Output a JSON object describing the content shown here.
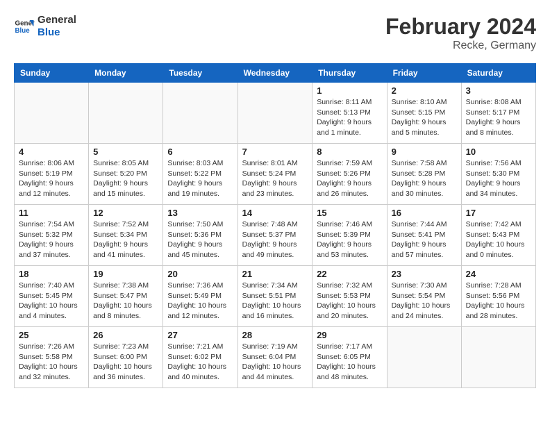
{
  "header": {
    "logo_line1": "General",
    "logo_line2": "Blue",
    "month_year": "February 2024",
    "location": "Recke, Germany"
  },
  "days_of_week": [
    "Sunday",
    "Monday",
    "Tuesday",
    "Wednesday",
    "Thursday",
    "Friday",
    "Saturday"
  ],
  "weeks": [
    [
      {
        "day": "",
        "info": ""
      },
      {
        "day": "",
        "info": ""
      },
      {
        "day": "",
        "info": ""
      },
      {
        "day": "",
        "info": ""
      },
      {
        "day": "1",
        "info": "Sunrise: 8:11 AM\nSunset: 5:13 PM\nDaylight: 9 hours\nand 1 minute."
      },
      {
        "day": "2",
        "info": "Sunrise: 8:10 AM\nSunset: 5:15 PM\nDaylight: 9 hours\nand 5 minutes."
      },
      {
        "day": "3",
        "info": "Sunrise: 8:08 AM\nSunset: 5:17 PM\nDaylight: 9 hours\nand 8 minutes."
      }
    ],
    [
      {
        "day": "4",
        "info": "Sunrise: 8:06 AM\nSunset: 5:19 PM\nDaylight: 9 hours\nand 12 minutes."
      },
      {
        "day": "5",
        "info": "Sunrise: 8:05 AM\nSunset: 5:20 PM\nDaylight: 9 hours\nand 15 minutes."
      },
      {
        "day": "6",
        "info": "Sunrise: 8:03 AM\nSunset: 5:22 PM\nDaylight: 9 hours\nand 19 minutes."
      },
      {
        "day": "7",
        "info": "Sunrise: 8:01 AM\nSunset: 5:24 PM\nDaylight: 9 hours\nand 23 minutes."
      },
      {
        "day": "8",
        "info": "Sunrise: 7:59 AM\nSunset: 5:26 PM\nDaylight: 9 hours\nand 26 minutes."
      },
      {
        "day": "9",
        "info": "Sunrise: 7:58 AM\nSunset: 5:28 PM\nDaylight: 9 hours\nand 30 minutes."
      },
      {
        "day": "10",
        "info": "Sunrise: 7:56 AM\nSunset: 5:30 PM\nDaylight: 9 hours\nand 34 minutes."
      }
    ],
    [
      {
        "day": "11",
        "info": "Sunrise: 7:54 AM\nSunset: 5:32 PM\nDaylight: 9 hours\nand 37 minutes."
      },
      {
        "day": "12",
        "info": "Sunrise: 7:52 AM\nSunset: 5:34 PM\nDaylight: 9 hours\nand 41 minutes."
      },
      {
        "day": "13",
        "info": "Sunrise: 7:50 AM\nSunset: 5:36 PM\nDaylight: 9 hours\nand 45 minutes."
      },
      {
        "day": "14",
        "info": "Sunrise: 7:48 AM\nSunset: 5:37 PM\nDaylight: 9 hours\nand 49 minutes."
      },
      {
        "day": "15",
        "info": "Sunrise: 7:46 AM\nSunset: 5:39 PM\nDaylight: 9 hours\nand 53 minutes."
      },
      {
        "day": "16",
        "info": "Sunrise: 7:44 AM\nSunset: 5:41 PM\nDaylight: 9 hours\nand 57 minutes."
      },
      {
        "day": "17",
        "info": "Sunrise: 7:42 AM\nSunset: 5:43 PM\nDaylight: 10 hours\nand 0 minutes."
      }
    ],
    [
      {
        "day": "18",
        "info": "Sunrise: 7:40 AM\nSunset: 5:45 PM\nDaylight: 10 hours\nand 4 minutes."
      },
      {
        "day": "19",
        "info": "Sunrise: 7:38 AM\nSunset: 5:47 PM\nDaylight: 10 hours\nand 8 minutes."
      },
      {
        "day": "20",
        "info": "Sunrise: 7:36 AM\nSunset: 5:49 PM\nDaylight: 10 hours\nand 12 minutes."
      },
      {
        "day": "21",
        "info": "Sunrise: 7:34 AM\nSunset: 5:51 PM\nDaylight: 10 hours\nand 16 minutes."
      },
      {
        "day": "22",
        "info": "Sunrise: 7:32 AM\nSunset: 5:53 PM\nDaylight: 10 hours\nand 20 minutes."
      },
      {
        "day": "23",
        "info": "Sunrise: 7:30 AM\nSunset: 5:54 PM\nDaylight: 10 hours\nand 24 minutes."
      },
      {
        "day": "24",
        "info": "Sunrise: 7:28 AM\nSunset: 5:56 PM\nDaylight: 10 hours\nand 28 minutes."
      }
    ],
    [
      {
        "day": "25",
        "info": "Sunrise: 7:26 AM\nSunset: 5:58 PM\nDaylight: 10 hours\nand 32 minutes."
      },
      {
        "day": "26",
        "info": "Sunrise: 7:23 AM\nSunset: 6:00 PM\nDaylight: 10 hours\nand 36 minutes."
      },
      {
        "day": "27",
        "info": "Sunrise: 7:21 AM\nSunset: 6:02 PM\nDaylight: 10 hours\nand 40 minutes."
      },
      {
        "day": "28",
        "info": "Sunrise: 7:19 AM\nSunset: 6:04 PM\nDaylight: 10 hours\nand 44 minutes."
      },
      {
        "day": "29",
        "info": "Sunrise: 7:17 AM\nSunset: 6:05 PM\nDaylight: 10 hours\nand 48 minutes."
      },
      {
        "day": "",
        "info": ""
      },
      {
        "day": "",
        "info": ""
      }
    ]
  ]
}
